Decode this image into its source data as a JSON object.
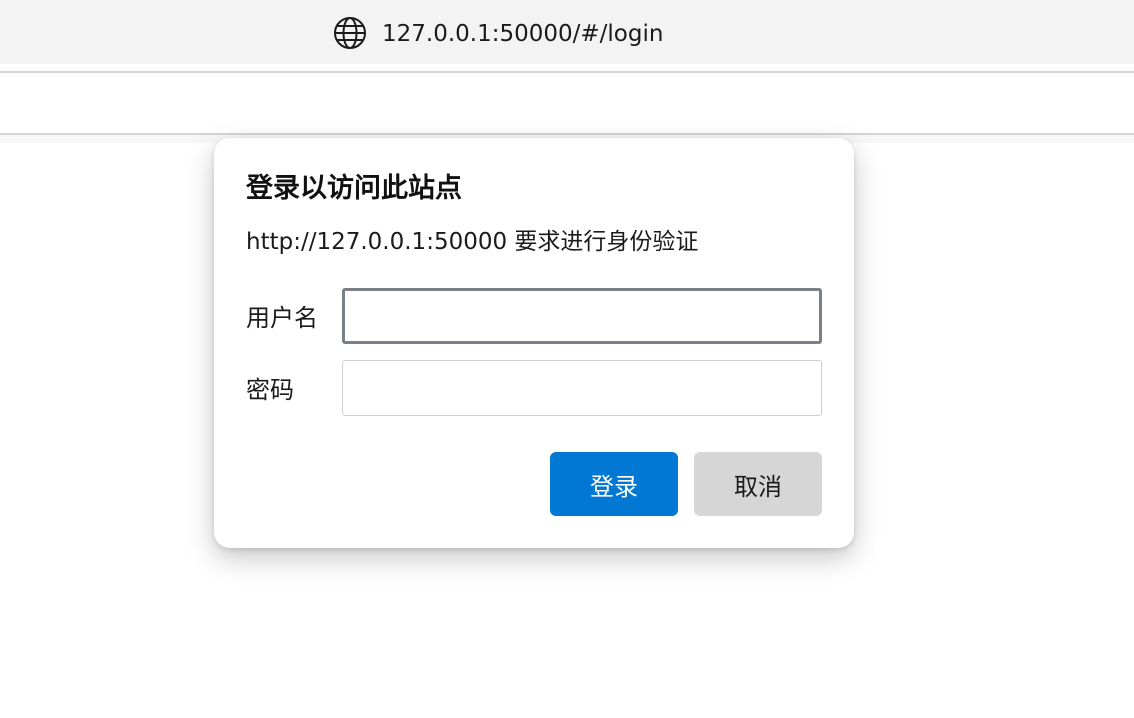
{
  "address_bar": {
    "url": "127.0.0.1:50000/#/login",
    "icon": "globe-icon"
  },
  "auth_dialog": {
    "title": "登录以访问此站点",
    "subtitle": "http://127.0.0.1:50000 要求进行身份验证",
    "username": {
      "label": "用户名",
      "value": ""
    },
    "password": {
      "label": "密码",
      "value": ""
    },
    "login_button": "登录",
    "cancel_button": "取消"
  },
  "colors": {
    "primary_button": "#0078d4",
    "secondary_button": "#d6d6d6",
    "focused_input_border": "#7a8085"
  }
}
